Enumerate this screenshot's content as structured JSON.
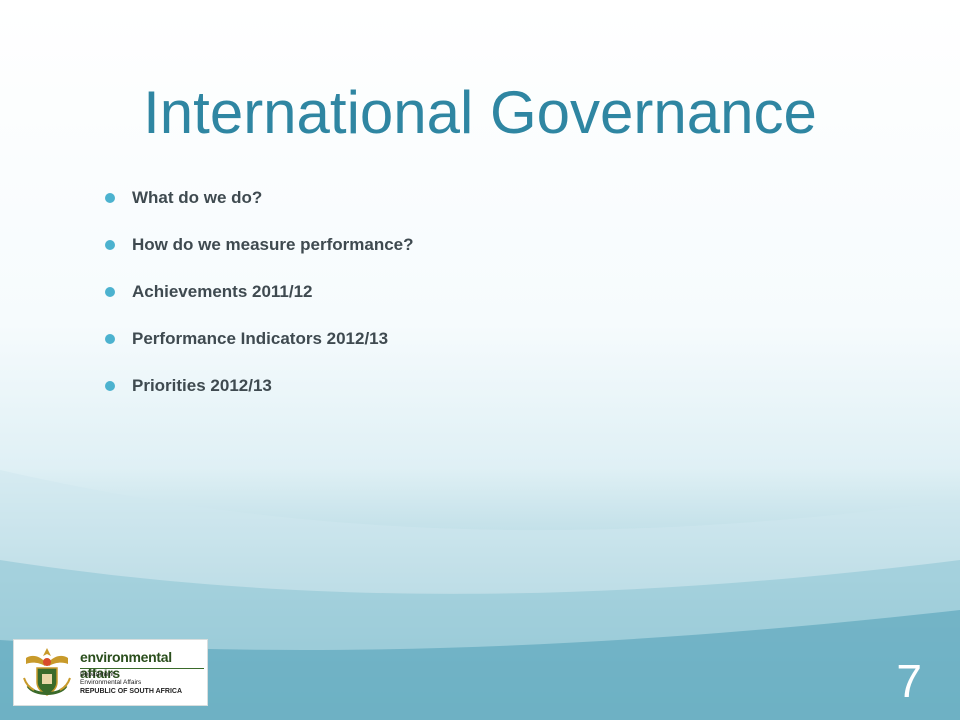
{
  "slide": {
    "title": "International Governance",
    "bullets": [
      "What do we do?",
      "How do we measure performance?",
      "Achievements 2011/12",
      "Performance Indicators 2012/13",
      "Priorities 2012/13"
    ],
    "number": "7"
  },
  "logo": {
    "name": "environmental affairs",
    "line1": "Department:",
    "line2": "Environmental Affairs",
    "line3": "REPUBLIC OF SOUTH AFRICA"
  },
  "colors": {
    "title": "#2f86a2",
    "bullet": "#4cb2cf",
    "text": "#3f4a50",
    "background_bottom": "#5fa9bd"
  }
}
